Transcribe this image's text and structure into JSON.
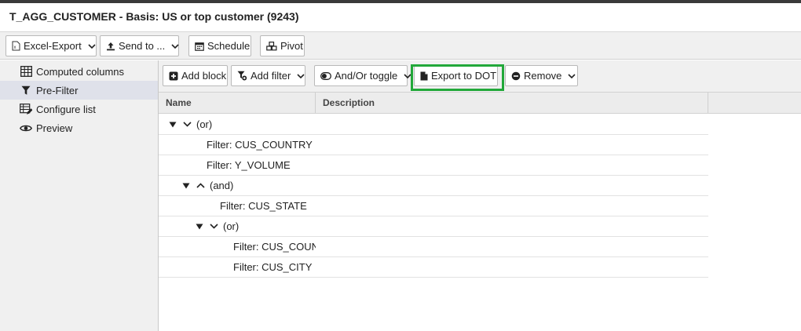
{
  "window": {
    "title": "T_AGG_CUSTOMER - Basis: US or top customer (9243)"
  },
  "toolbar": {
    "excel_export": "Excel-Export",
    "send_to": "Send to ...",
    "schedule": "Schedule",
    "pivot": "Pivot"
  },
  "sidebar": {
    "items": [
      {
        "label": "Computed columns",
        "icon": "grid-icon"
      },
      {
        "label": "Pre-Filter",
        "icon": "filter-icon",
        "active": true
      },
      {
        "label": "Configure list",
        "icon": "table-edit-icon"
      },
      {
        "label": "Preview",
        "icon": "eye-icon"
      }
    ]
  },
  "subtoolbar": {
    "add_block": "Add block",
    "add_filter": "Add filter",
    "and_or_toggle": "And/Or toggle",
    "export_dot": "Export to DOT",
    "remove": "Remove"
  },
  "tree": {
    "columns": [
      "Name",
      "Description"
    ],
    "rows": [
      {
        "label": "(or)",
        "type": "group",
        "op": "or"
      },
      {
        "label": "Filter: CUS_COUNTRY",
        "type": "filter"
      },
      {
        "label": "Filter: Y_VOLUME",
        "type": "filter"
      },
      {
        "label": "(and)",
        "type": "group",
        "op": "and"
      },
      {
        "label": "Filter: CUS_STATE",
        "type": "filter"
      },
      {
        "label": "(or)",
        "type": "group",
        "op": "or"
      },
      {
        "label": "Filter: CUS_COUNTRY",
        "type": "filter"
      },
      {
        "label": "Filter: CUS_CITY",
        "type": "filter"
      }
    ]
  }
}
